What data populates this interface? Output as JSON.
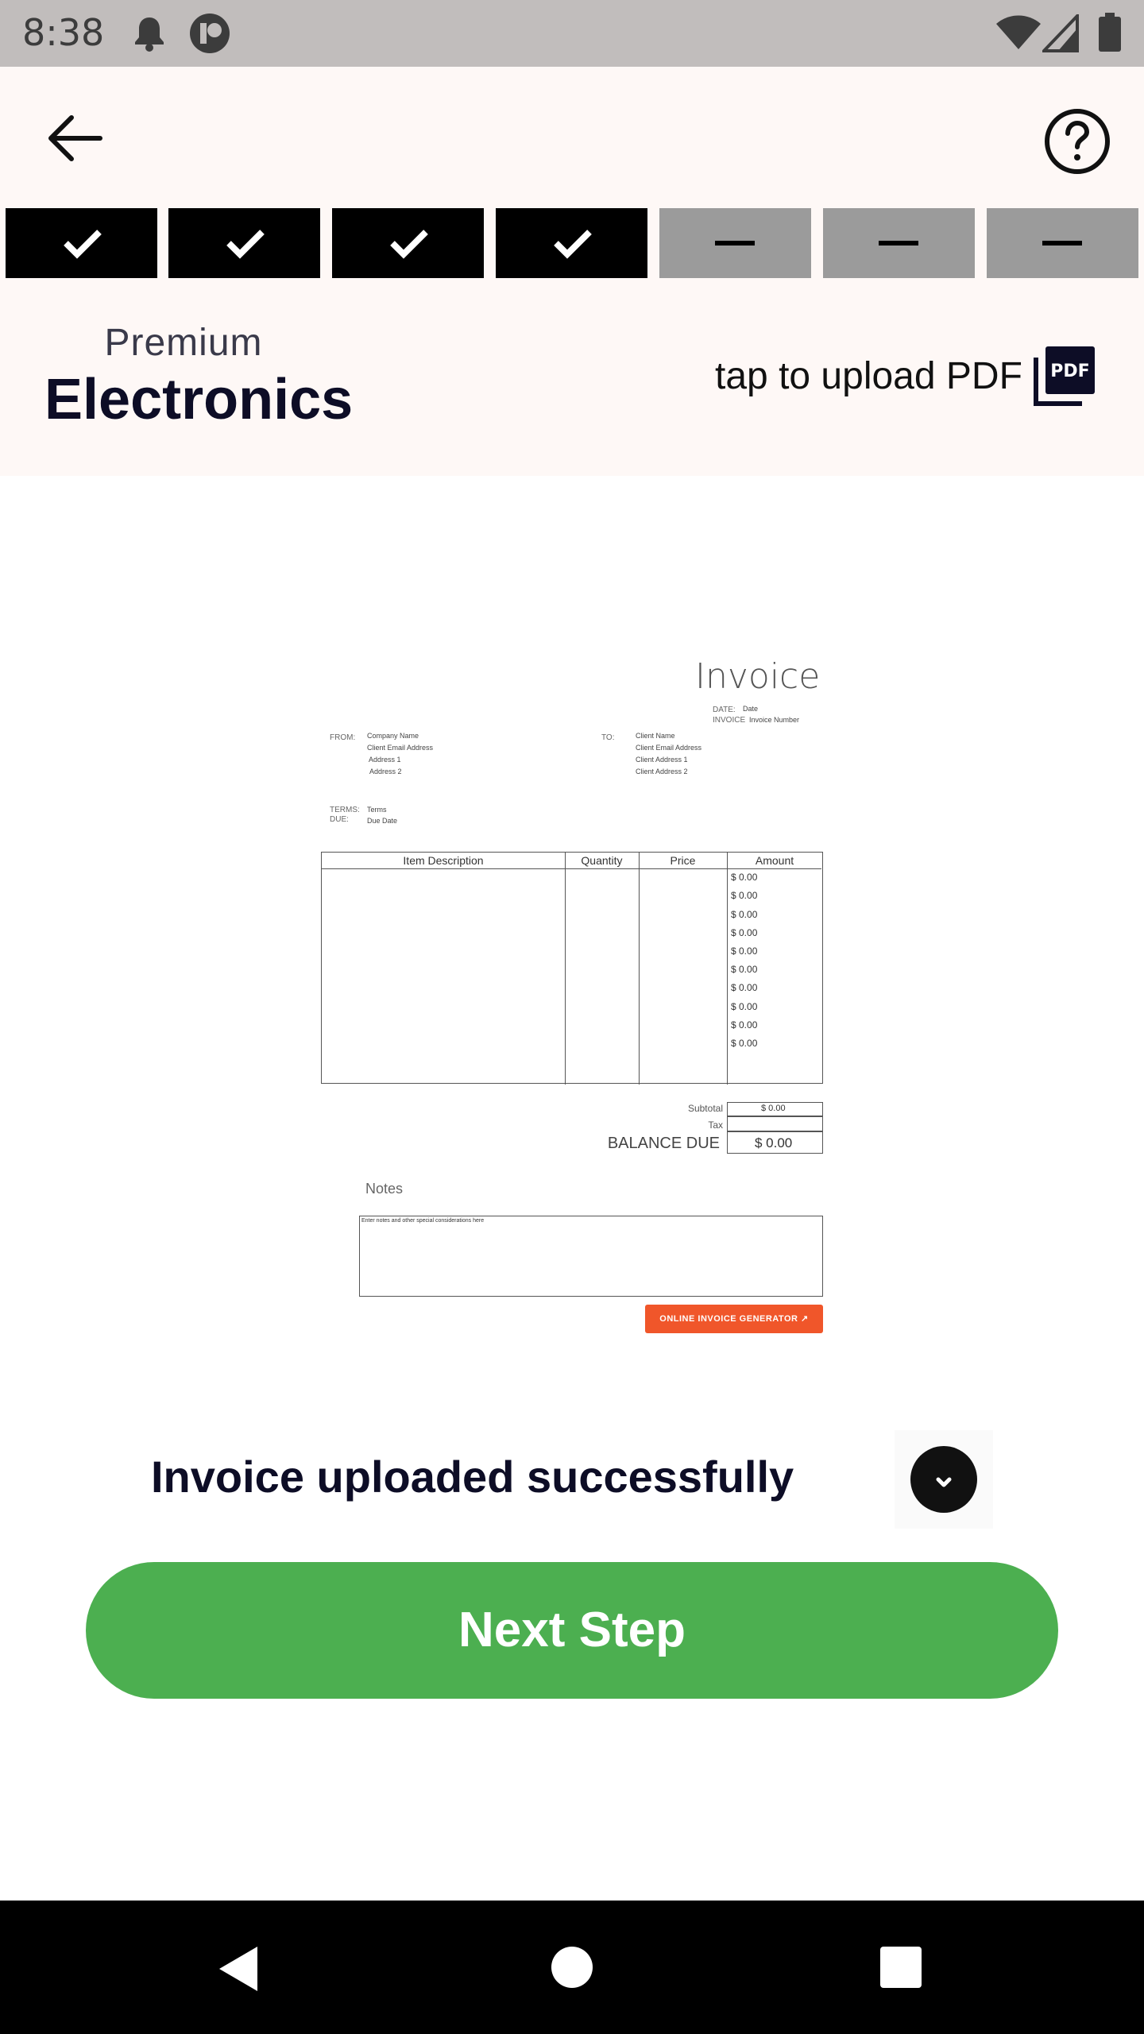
{
  "status_bar": {
    "time": "8:38",
    "icons": [
      "bell-icon",
      "app-icon",
      "wifi-icon",
      "signal-icon",
      "battery-icon"
    ]
  },
  "header": {
    "back_icon": "arrow-left-icon",
    "help_icon": "help-circle-icon"
  },
  "steps": [
    {
      "state": "done",
      "icon": "check-icon"
    },
    {
      "state": "done",
      "icon": "check-icon"
    },
    {
      "state": "done",
      "icon": "check-icon"
    },
    {
      "state": "done",
      "icon": "check-icon"
    },
    {
      "state": "todo",
      "icon": "dash-icon"
    },
    {
      "state": "todo",
      "icon": "dash-icon"
    },
    {
      "state": "todo",
      "icon": "dash-icon"
    }
  ],
  "category": {
    "subtitle": "Premium",
    "title": "Electronics"
  },
  "upload": {
    "label": "tap to upload PDF",
    "icon": "pdf-icon"
  },
  "invoice": {
    "title": "Invoice",
    "date_label": "DATE:",
    "date_value": "Date",
    "invoice_label": "INVOICE",
    "invoice_value": "Invoice Number",
    "from_label": "FROM:",
    "from_lines": [
      "Company Name",
      "Client Email Address",
      "Address 1",
      "Address 2"
    ],
    "to_label": "TO:",
    "to_lines": [
      "Client Name",
      "Client Email Address",
      "Client Address 1",
      "Client Address 2"
    ],
    "terms_label": "TERMS:",
    "terms_value": "Terms",
    "due_label": "DUE:",
    "due_value": "Due Date",
    "columns": [
      "Item Description",
      "Quantity",
      "Price",
      "Amount"
    ],
    "amounts": [
      "$ 0.00",
      "$ 0.00",
      "$ 0.00",
      "$ 0.00",
      "$ 0.00",
      "$ 0.00",
      "$ 0.00",
      "$ 0.00",
      "$ 0.00",
      "$ 0.00"
    ],
    "subtotal_label": "Subtotal",
    "subtotal_value": "$ 0.00",
    "tax_label": "Tax",
    "balance_label": "BALANCE DUE",
    "balance_value": "$ 0.00",
    "notes_label": "Notes",
    "notes_text": "Enter notes and other special considerations here",
    "generator_button": "ONLINE INVOICE GENERATOR ↗"
  },
  "success": {
    "message": "Invoice uploaded successfully",
    "collapse_icon": "chevron-down-icon"
  },
  "next_button": "Next Step",
  "nav_bar": {
    "icons": [
      "back-triangle-icon",
      "home-circle-icon",
      "recents-square-icon"
    ]
  },
  "colors": {
    "accent_green": "#4caf50",
    "step_done": "#000000",
    "step_todo": "#9b9b9b",
    "header_bg": "#fef8f6",
    "generator_orange": "#f0562a"
  }
}
